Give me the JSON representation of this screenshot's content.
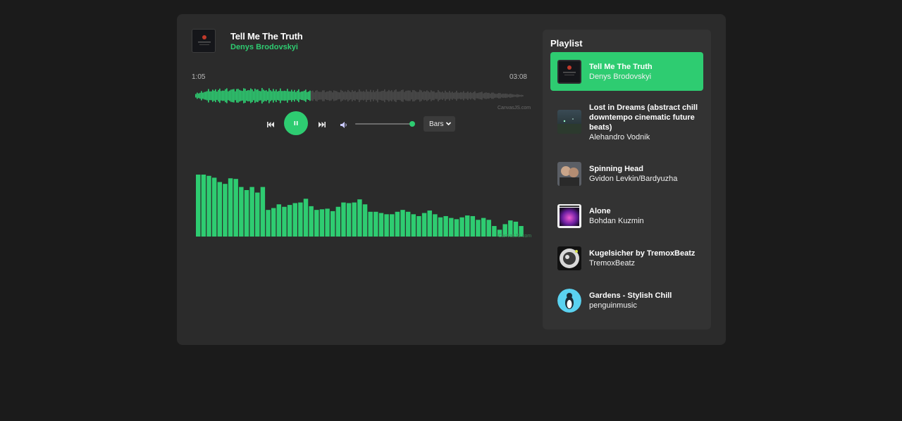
{
  "now_playing": {
    "title": "Tell Me The Truth",
    "artist": "Denys Brodovskyi",
    "current_time": "1:05",
    "total_time": "03:08",
    "progress": 0.35
  },
  "waveform": {
    "credit": "CanvasJS.com",
    "played_color": "#2ecc71",
    "unplayed_color": "#4a4a4a"
  },
  "controls": {
    "prev_icon": "skip-previous-icon",
    "play_state": "pause-icon",
    "next_icon": "skip-next-icon",
    "volume_icon": "volume-icon",
    "volume_level": 0.98,
    "mode_select": {
      "value": "Bars"
    }
  },
  "visualizer": {
    "credit": "CanvasJS.com",
    "color": "#2ecc71",
    "levels": [
      1.0,
      1.0,
      0.98,
      0.95,
      0.88,
      0.85,
      0.94,
      0.93,
      0.8,
      0.75,
      0.8,
      0.71,
      0.8,
      0.43,
      0.46,
      0.52,
      0.48,
      0.51,
      0.54,
      0.55,
      0.61,
      0.49,
      0.43,
      0.44,
      0.45,
      0.41,
      0.48,
      0.55,
      0.54,
      0.55,
      0.6,
      0.52,
      0.4,
      0.4,
      0.38,
      0.36,
      0.36,
      0.4,
      0.43,
      0.4,
      0.36,
      0.33,
      0.38,
      0.42,
      0.36,
      0.31,
      0.33,
      0.3,
      0.28,
      0.31,
      0.34,
      0.33,
      0.27,
      0.3,
      0.27,
      0.17,
      0.11,
      0.2,
      0.26,
      0.24,
      0.17
    ]
  },
  "playlist": {
    "heading": "Playlist",
    "items": [
      {
        "title": "Tell Me The Truth",
        "artist": "Denys Brodovskyi",
        "active": true
      },
      {
        "title": "Lost in Dreams (abstract chill downtempo cinematic future beats)",
        "artist": "Alehandro Vodnik",
        "active": false
      },
      {
        "title": "Spinning Head",
        "artist": "Gvidon Levkin/Bardyuzha",
        "active": false
      },
      {
        "title": "Alone",
        "artist": "Bohdan Kuzmin",
        "active": false
      },
      {
        "title": "Kugelsicher by TremoxBeatz",
        "artist": "TremoxBeatz",
        "active": false
      },
      {
        "title": "Gardens - Stylish Chill",
        "artist": "penguinmusic",
        "active": false
      }
    ]
  }
}
